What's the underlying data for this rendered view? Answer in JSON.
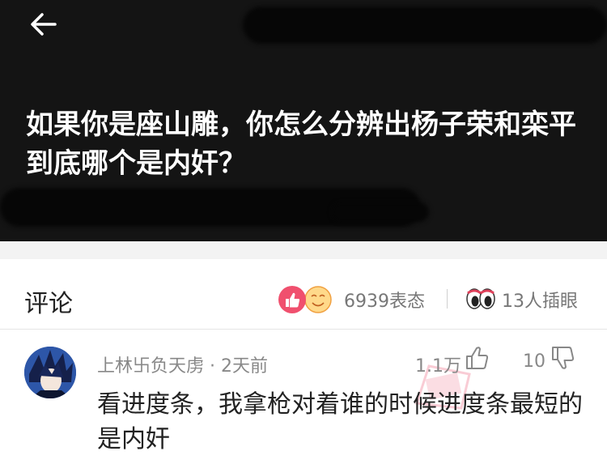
{
  "header": {
    "title": "如果你是座山雕，你怎么分辨出杨子荣和栾平到底哪个是内奸？",
    "back_icon": "arrow-left-icon"
  },
  "comments_bar": {
    "label": "评论",
    "reactions_count": "6939表态",
    "views_count": "13人插眼",
    "reaction_icons": [
      "thumbs-up-icon",
      "smile-emoji-icon"
    ],
    "eyes_icon": "eyes-icon"
  },
  "comment": {
    "author_meta": "上林卐负天虏 · 2天前",
    "like_count": "1.1万",
    "dislike_count": "10",
    "text": "看进度条，我拿枪对着谁的时候进度条最短的是内奸"
  },
  "colors": {
    "header_bg": "#141414",
    "reaction_pink": "#f0506e"
  }
}
